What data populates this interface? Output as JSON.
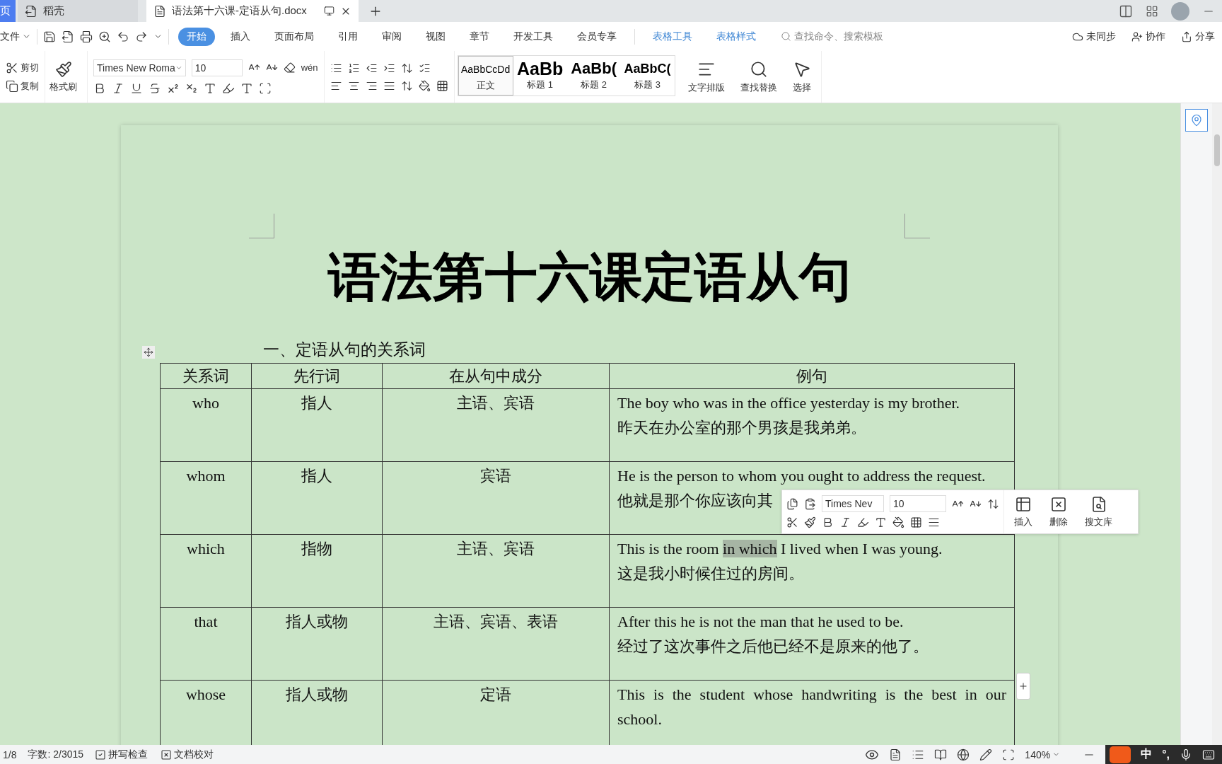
{
  "tabs": [
    {
      "label": "页",
      "kind": "home",
      "selected": false
    },
    {
      "label": "稻壳",
      "kind": "docer",
      "selected": false
    },
    {
      "label": "语法第十六课-定语从句.docx",
      "kind": "doc",
      "selected": true
    }
  ],
  "menu": {
    "file": "文件",
    "items": [
      {
        "label": "开始",
        "kind": "main",
        "selected": true
      },
      {
        "label": "插入",
        "kind": "main",
        "selected": false
      },
      {
        "label": "页面布局",
        "kind": "main",
        "selected": false
      },
      {
        "label": "引用",
        "kind": "main",
        "selected": false
      },
      {
        "label": "审阅",
        "kind": "main",
        "selected": false
      },
      {
        "label": "视图",
        "kind": "main",
        "selected": false
      },
      {
        "label": "章节",
        "kind": "main",
        "selected": false
      },
      {
        "label": "开发工具",
        "kind": "main",
        "selected": false
      },
      {
        "label": "会员专享",
        "kind": "main",
        "selected": false
      },
      {
        "label": "表格工具",
        "kind": "context",
        "selected": false
      },
      {
        "label": "表格样式",
        "kind": "context",
        "selected": false
      }
    ],
    "search": {
      "placeholder": "查找命令、搜索模板"
    },
    "actions": [
      "未同步",
      "协作",
      "分享"
    ]
  },
  "ribbon": {
    "cut": "剪切",
    "copy": "复制",
    "painter": "格式刷",
    "font": "Times New Roma",
    "size": "10",
    "phonetic": "wén",
    "styles": [
      {
        "preview": "AaBbCcDd",
        "label": "正文",
        "kind": "body",
        "selected": true
      },
      {
        "preview": "AaBb",
        "label": "标题 1",
        "kind": "h1",
        "selected": false
      },
      {
        "preview": "AaBb(",
        "label": "标题 2",
        "kind": "h2",
        "selected": false
      },
      {
        "preview": "AaBbC(",
        "label": "标题 3",
        "kind": "h3",
        "selected": false
      }
    ],
    "tools": [
      "文字排版",
      "查找替换",
      "选择"
    ]
  },
  "document": {
    "title": "语法第十六课定语从句",
    "heading": "一、定语从句的关系词",
    "table": {
      "columns": [
        "关系词",
        "先行词",
        "在从句中成分",
        "例句"
      ],
      "rows": [
        {
          "word": "who",
          "antecedent": "指人",
          "role": "主语、宾语",
          "en": [
            {
              "text": "The boy who was in the office yesterday is my brother.",
              "selected": false
            }
          ],
          "zh": "昨天在办公室的那个男孩是我弟弟。"
        },
        {
          "word": "whom",
          "antecedent": "指人",
          "role": "宾语",
          "en": [
            {
              "text": "He is the person to whom you ought to address the request.",
              "selected": false
            }
          ],
          "zh": "他就是那个你应该向其"
        },
        {
          "word": "which",
          "antecedent": "指物",
          "role": "主语、宾语",
          "en": [
            {
              "text": "This is the room ",
              "selected": false
            },
            {
              "text": "in which",
              "selected": true
            },
            {
              "text": " I lived when I was young.",
              "selected": false
            }
          ],
          "zh": "这是我小时候住过的房间。"
        },
        {
          "word": "that",
          "antecedent": "指人或物",
          "role": "主语、宾语、表语",
          "en": [
            {
              "text": "After this he is not the man that he used to be.",
              "selected": false
            }
          ],
          "zh": "经过了这次事件之后他已经不是原来的他了。"
        },
        {
          "word": "whose",
          "antecedent": "指人或物",
          "role": "定语",
          "en": [
            {
              "text": "This is the student whose handwriting is the best in our school.",
              "selected": false
            }
          ]
        }
      ]
    }
  },
  "float_toolbar": {
    "font": "Times Nev",
    "size": "10",
    "actions": [
      "插入",
      "删除",
      "搜文库"
    ]
  },
  "status": {
    "page": "1/8",
    "words": "字数: 2/3015",
    "spell": "拼写检查",
    "proof": "文档校对",
    "zoom": "140%"
  },
  "ime": {
    "lang": "中",
    "punct": "°,"
  }
}
